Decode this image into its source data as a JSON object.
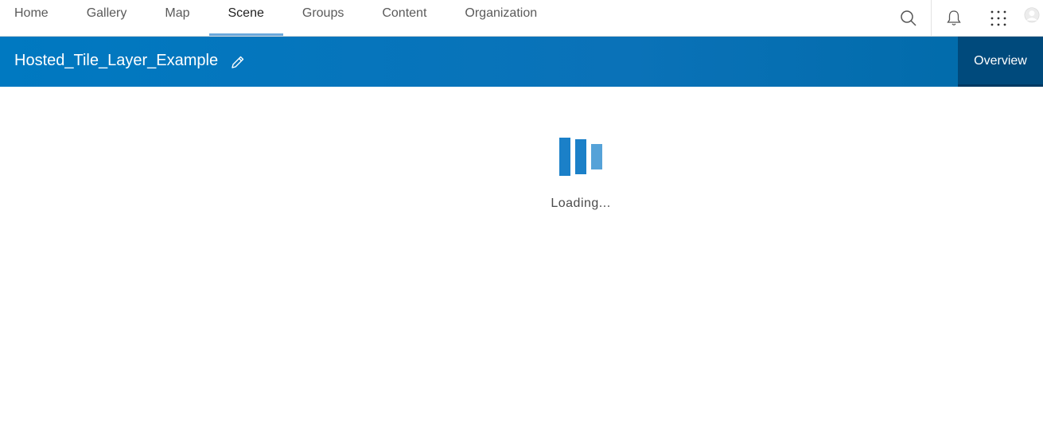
{
  "nav": {
    "tabs": [
      {
        "label": "Home"
      },
      {
        "label": "Gallery"
      },
      {
        "label": "Map"
      },
      {
        "label": "Scene",
        "active": true
      },
      {
        "label": "Groups"
      },
      {
        "label": "Content"
      },
      {
        "label": "Organization"
      }
    ],
    "icons": [
      "search-icon",
      "bell-icon",
      "apps-grid-icon",
      "avatar"
    ]
  },
  "titlebar": {
    "title": "Hosted_Tile_Layer_Example",
    "overview_label": "Overview"
  },
  "loader": {
    "text": "Loading..."
  },
  "colors": {
    "brand_blue": "#0079c1",
    "overview_bg": "#004a7c",
    "active_tab_underline": "#6aa8dc",
    "loader_blue": "#1b80c8"
  }
}
